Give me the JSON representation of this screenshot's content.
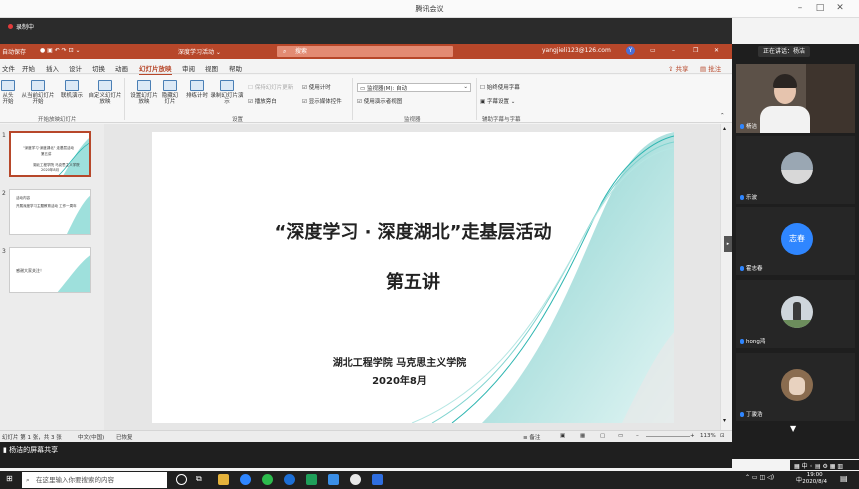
{
  "meeting": {
    "title": "腾讯会议"
  },
  "recording": {
    "badge": "录制中"
  },
  "ppt": {
    "autosave": "自动保存",
    "doc_title": "深度学习活动 ⌄",
    "search_placeholder": "搜索",
    "user_email": "yangjieli123@126.com",
    "user_initial": "Y",
    "share_label": "共享",
    "comment_label": "批注"
  },
  "ribbon_tabs": [
    "文件",
    "开始",
    "插入",
    "设计",
    "切换",
    "动画",
    "幻灯片放映",
    "审阅",
    "视图",
    "帮助"
  ],
  "ribbon": {
    "start": {
      "from_beginning": "从头开始",
      "from_current": "从当前幻灯片开始",
      "online": "联机演示",
      "custom": "自定义幻灯片放映",
      "group": "开始放映幻灯片"
    },
    "setup": {
      "setup_show": "设置幻灯片放映",
      "hide_slide": "隐藏幻灯片",
      "rehearse": "排练计时",
      "record": "录制幻灯片演示",
      "play_narration": "播放旁白",
      "use_timing": "使用计时",
      "show_media": "显示媒体控件",
      "keep_updated": "保持幻灯片更新",
      "group": "设置"
    },
    "monitor": {
      "monitor_label": "监视器(M): 自动",
      "presenter_view": "使用演示者视图",
      "group": "监视器"
    },
    "captions": {
      "always_captions": "始终使用字幕",
      "caption_settings": "字幕设置",
      "group": "辅助字幕与字幕"
    }
  },
  "thumbnails": [
    {
      "num": "1",
      "line1": "\"深度学习·深度湖北\" 走基层活动",
      "line2": "第五讲",
      "line3": "湖北工程学院 马克思主义学院",
      "line4": "2020年8月"
    },
    {
      "num": "2",
      "line1": "活动内容",
      "line2": "开展深度学习主题教育活动 工作一周年",
      "line3": "",
      "line4": ""
    },
    {
      "num": "3",
      "line1": "感谢大家关注！",
      "line2": "",
      "line3": "",
      "line4": ""
    }
  ],
  "slide": {
    "title": "“深度学习 · 深度湖北”走基层活动",
    "subtitle": "第五讲",
    "org": "湖北工程学院 马克思主义学院",
    "date": "2020年8月"
  },
  "status": {
    "slide_info": "幻灯片 第 1 张，共 3 张",
    "language": "中文(中国)",
    "accessibility": "已恢复",
    "notes": "备注",
    "zoom": "113%"
  },
  "share": {
    "text": "杨洁的屏幕共享"
  },
  "participants": {
    "speaking": "正在讲话：杨洁",
    "list": [
      {
        "name": "杨洁",
        "avatar": ""
      },
      {
        "name": "乐波",
        "avatar": ""
      },
      {
        "name": "霍志春",
        "avatar": "志春"
      },
      {
        "name": "hong鸿",
        "avatar": ""
      },
      {
        "name": "丁骏浩",
        "avatar": ""
      }
    ]
  },
  "taskbar": {
    "search_placeholder": "在这里输入你要搜索的内容",
    "time": "19:00",
    "date": "2020/8/4",
    "ime": "中"
  },
  "colors": {
    "ppt_red": "#b7472a",
    "accent_blue": "#2f86ff",
    "teal": "#2cb5b0"
  }
}
